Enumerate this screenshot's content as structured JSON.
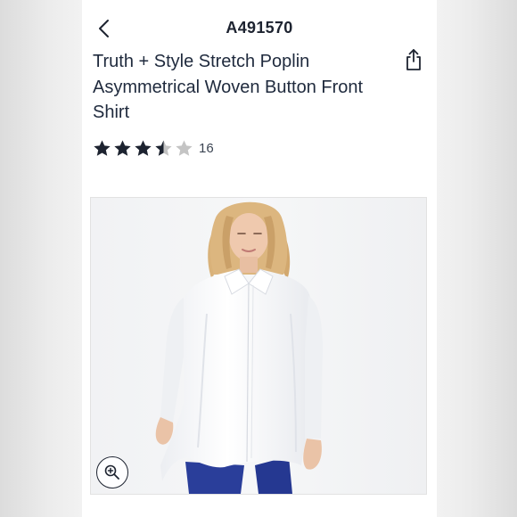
{
  "header": {
    "item_number": "A491570",
    "back_icon": "chevron-left-icon",
    "share_icon": "share-icon"
  },
  "product": {
    "title": "Truth + Style Stretch Poplin Asymmetrical Woven Button Front Shirt",
    "rating": 3.5,
    "rating_max": 5,
    "review_count": "16"
  },
  "image": {
    "zoom_icon": "zoom-in-icon"
  },
  "colors": {
    "text_primary": "#1f2a3d",
    "star_filled": "#1d2330",
    "star_empty": "#c4c4c4",
    "pants": "#2a3e9a"
  }
}
